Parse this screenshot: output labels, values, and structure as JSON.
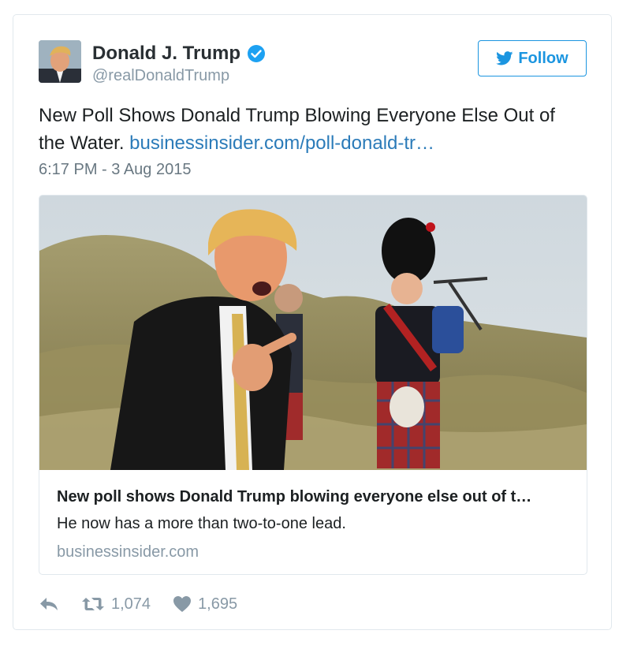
{
  "tweet": {
    "display_name": "Donald J. Trump",
    "handle": "@realDonaldTrump",
    "follow_label": "Follow",
    "text": "New Poll Shows Donald Trump Blowing Everyone Else Out of the Water.",
    "link_text": "businessinsider.com/poll-donald-tr…",
    "timestamp": "6:17 PM - 3 Aug 2015",
    "verified": true
  },
  "card": {
    "title": "New poll shows Donald Trump blowing everyone else out of t…",
    "description": "He now has a more than two-to-one lead.",
    "domain": "businessinsider.com"
  },
  "actions": {
    "reply_icon": "reply-icon",
    "retweet_icon": "retweet-icon",
    "retweet_count": "1,074",
    "like_icon": "heart-icon",
    "like_count": "1,695"
  },
  "colors": {
    "accent": "#1b95e0",
    "link": "#2b7bb9",
    "muted": "#8899a6",
    "border": "#e1e8ed"
  }
}
